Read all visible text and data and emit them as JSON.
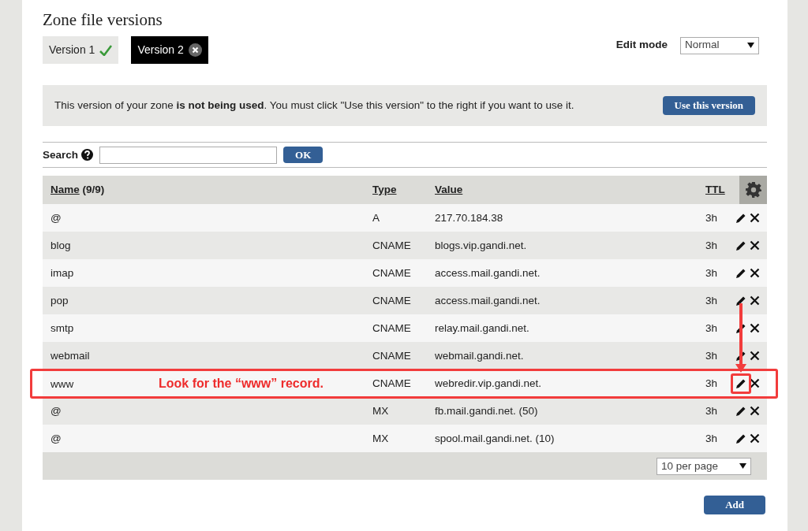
{
  "title": "Zone file versions",
  "versions": [
    {
      "label": "Version 1",
      "selected": false,
      "in_use": true
    },
    {
      "label": "Version 2",
      "selected": true,
      "in_use": false
    }
  ],
  "edit_mode": {
    "label": "Edit mode",
    "value": "Normal"
  },
  "notice": {
    "text": "This version of your zone **is not being used**. You must click \"Use this version\" to the right if you want to use it.",
    "button": "Use this version"
  },
  "search": {
    "label": "Search",
    "button": "OK"
  },
  "table": {
    "columns": [
      {
        "label": "Name",
        "suffix": "(9/9)"
      },
      {
        "label": "Type"
      },
      {
        "label": "Value"
      },
      {
        "label": "TTL"
      }
    ],
    "rows": [
      {
        "name": "@",
        "type": "A",
        "value": "217.70.184.38",
        "ttl": "3h",
        "highlighted": false
      },
      {
        "name": "blog",
        "type": "CNAME",
        "value": "blogs.vip.gandi.net.",
        "ttl": "3h",
        "highlighted": false
      },
      {
        "name": "imap",
        "type": "CNAME",
        "value": "access.mail.gandi.net.",
        "ttl": "3h",
        "highlighted": false
      },
      {
        "name": "pop",
        "type": "CNAME",
        "value": "access.mail.gandi.net.",
        "ttl": "3h",
        "highlighted": false
      },
      {
        "name": "smtp",
        "type": "CNAME",
        "value": "relay.mail.gandi.net.",
        "ttl": "3h",
        "highlighted": false
      },
      {
        "name": "webmail",
        "type": "CNAME",
        "value": "webmail.gandi.net.",
        "ttl": "3h",
        "highlighted": false
      },
      {
        "name": "www",
        "type": "CNAME",
        "value": "webredir.vip.gandi.net.",
        "ttl": "3h",
        "highlighted": true
      },
      {
        "name": "@",
        "type": "MX",
        "value": "fb.mail.gandi.net. (50)",
        "ttl": "3h",
        "highlighted": false
      },
      {
        "name": "@",
        "type": "MX",
        "value": "spool.mail.gandi.net. (10)",
        "ttl": "3h",
        "highlighted": false
      }
    ]
  },
  "pagination": {
    "value": "10 per page"
  },
  "add_button": "Add",
  "annotation": {
    "text": "Look for the “www” record."
  }
}
